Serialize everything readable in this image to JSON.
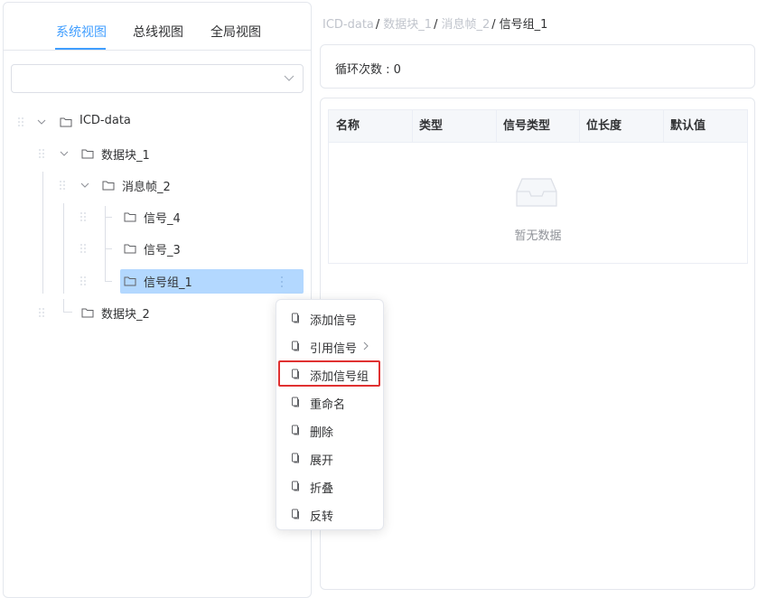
{
  "tabs": [
    {
      "label": "系统视图",
      "active": true
    },
    {
      "label": "总线视图",
      "active": false
    },
    {
      "label": "全局视图",
      "active": false
    }
  ],
  "select": {
    "value": ""
  },
  "tree": {
    "root": "ICD-data",
    "block1": "数据块_1",
    "frame2": "消息帧_2",
    "signal4": "信号_4",
    "signal3": "信号_3",
    "group1": "信号组_1",
    "block2": "数据块_2"
  },
  "breadcrumb": {
    "items": [
      "ICD-data",
      "数据块_1",
      "消息帧_2"
    ],
    "separator": "/",
    "current": "信号组_1"
  },
  "loop": {
    "text": "循环次数 : 0"
  },
  "table": {
    "columns": [
      "名称",
      "类型",
      "信号类型",
      "位长度",
      "默认值"
    ],
    "empty_text": "暂无数据"
  },
  "context_menu": {
    "items": [
      {
        "label": "添加信号",
        "submenu": false
      },
      {
        "label": "引用信号",
        "submenu": true
      },
      {
        "label": "添加信号组",
        "submenu": false,
        "highlighted": true
      },
      {
        "label": "重命名",
        "submenu": false
      },
      {
        "label": "删除",
        "submenu": false
      },
      {
        "label": "展开",
        "submenu": false
      },
      {
        "label": "折叠",
        "submenu": false
      },
      {
        "label": "反转",
        "submenu": false
      }
    ]
  },
  "colors": {
    "accent": "#409eff",
    "selected_row": "#b3d8ff",
    "highlight_box": "#e03131"
  },
  "icons": {
    "tree_folder": "folder-icon",
    "tree_caret": "chevron-down-icon",
    "drag": "drag-handle-icon",
    "menu_item": "document-icon",
    "more": "more-vertical-icon",
    "empty": "inbox-icon"
  }
}
